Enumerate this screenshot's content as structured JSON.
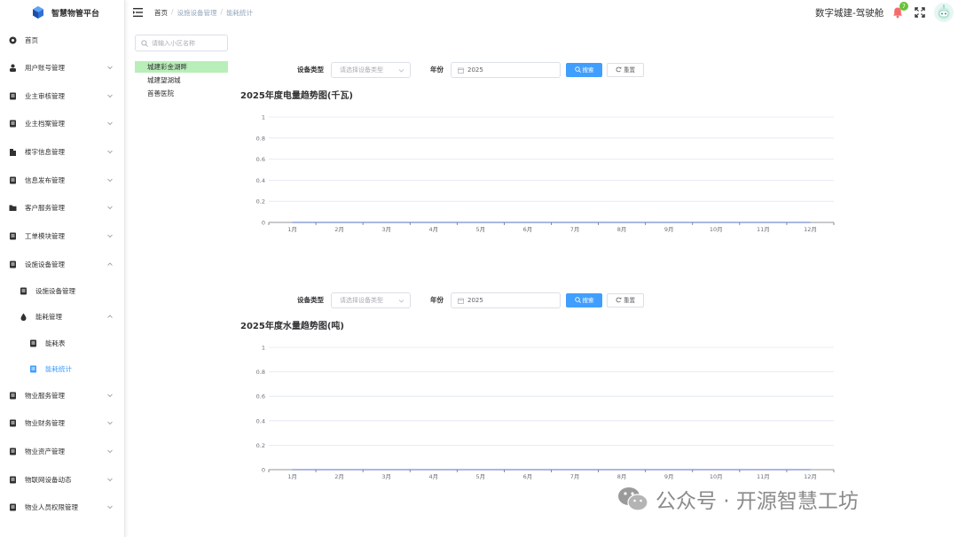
{
  "app": {
    "title": "智慧物管平台"
  },
  "sidebar": {
    "items": [
      {
        "label": "首页",
        "icon": "dashboard-icon",
        "expandable": false
      },
      {
        "label": "用户账号管理",
        "icon": "user-icon",
        "expandable": true
      },
      {
        "label": "业主审核管理",
        "icon": "audit-icon",
        "expandable": true
      },
      {
        "label": "业主档案管理",
        "icon": "archive-icon",
        "expandable": true
      },
      {
        "label": "楼宇信息管理",
        "icon": "building-icon",
        "expandable": true
      },
      {
        "label": "信息发布管理",
        "icon": "publish-icon",
        "expandable": true
      },
      {
        "label": "客户服务管理",
        "icon": "folder-icon",
        "expandable": true
      },
      {
        "label": "工单模块管理",
        "icon": "workorder-icon",
        "expandable": true
      },
      {
        "label": "设施设备管理",
        "icon": "equipment-icon",
        "expandable": true,
        "expanded": true
      },
      {
        "label": "设施设备管理",
        "icon": "equipment-icon",
        "level": 2
      },
      {
        "label": "能耗管理",
        "icon": "drop-icon",
        "level": 2,
        "expandable": true,
        "expanded": true
      },
      {
        "label": "能耗表",
        "icon": "table-icon",
        "level": 3
      },
      {
        "label": "能耗统计",
        "icon": "stats-icon",
        "level": 3,
        "active": true
      },
      {
        "label": "物业服务管理",
        "icon": "service-icon",
        "expandable": true
      },
      {
        "label": "物业财务管理",
        "icon": "finance-icon",
        "expandable": true
      },
      {
        "label": "物业资产管理",
        "icon": "asset-icon",
        "expandable": true
      },
      {
        "label": "物联网设备动态",
        "icon": "iot-icon",
        "expandable": true
      },
      {
        "label": "物业人员权限管理",
        "icon": "permission-icon",
        "expandable": true
      }
    ]
  },
  "header": {
    "breadcrumb": [
      "首页",
      "设施设备管理",
      "能耗统计"
    ],
    "user_name": "数字城建-驾驶舱",
    "notification_count": "7"
  },
  "tree": {
    "search_placeholder": "请输入小区名称",
    "nodes": [
      "城建彩金湖畔",
      "城建望湖城",
      "首善医院"
    ],
    "selected_index": 0
  },
  "filters": {
    "device_type_label": "设备类型",
    "device_type_placeholder": "请选择设备类型",
    "year_label": "年份",
    "year_value": "2025",
    "search_button": "搜索",
    "reset_button": "重置"
  },
  "colors": {
    "accent": "#409eff",
    "tree_selected": "#b8eeb8",
    "badge": "#67c23a",
    "bell": "#f56c6c"
  },
  "chart_data": [
    {
      "type": "line",
      "title": "2025年度电量趋势图(千瓦)",
      "categories": [
        "1月",
        "2月",
        "3月",
        "4月",
        "5月",
        "6月",
        "7月",
        "8月",
        "9月",
        "10月",
        "11月",
        "12月"
      ],
      "series": [
        {
          "values": [
            0,
            0,
            0,
            0,
            0,
            0,
            0,
            0,
            0,
            0,
            0,
            0
          ]
        }
      ],
      "y_ticks": [
        "0",
        "0.2",
        "0.4",
        "0.6",
        "0.8",
        "1"
      ],
      "ylim": [
        0,
        1
      ],
      "grid": true
    },
    {
      "type": "line",
      "title": "2025年度水量趋势图(吨)",
      "categories": [
        "1月",
        "2月",
        "3月",
        "4月",
        "5月",
        "6月",
        "7月",
        "8月",
        "9月",
        "10月",
        "11月",
        "12月"
      ],
      "series": [
        {
          "values": [
            0,
            0,
            0,
            0,
            0,
            0,
            0,
            0,
            0,
            0,
            0,
            0
          ]
        }
      ],
      "y_ticks": [
        "0",
        "0.2",
        "0.4",
        "0.6",
        "0.8",
        "1"
      ],
      "ylim": [
        0,
        1
      ],
      "grid": true
    }
  ],
  "watermark": {
    "text": "公众号 · 开源智慧工坊"
  }
}
